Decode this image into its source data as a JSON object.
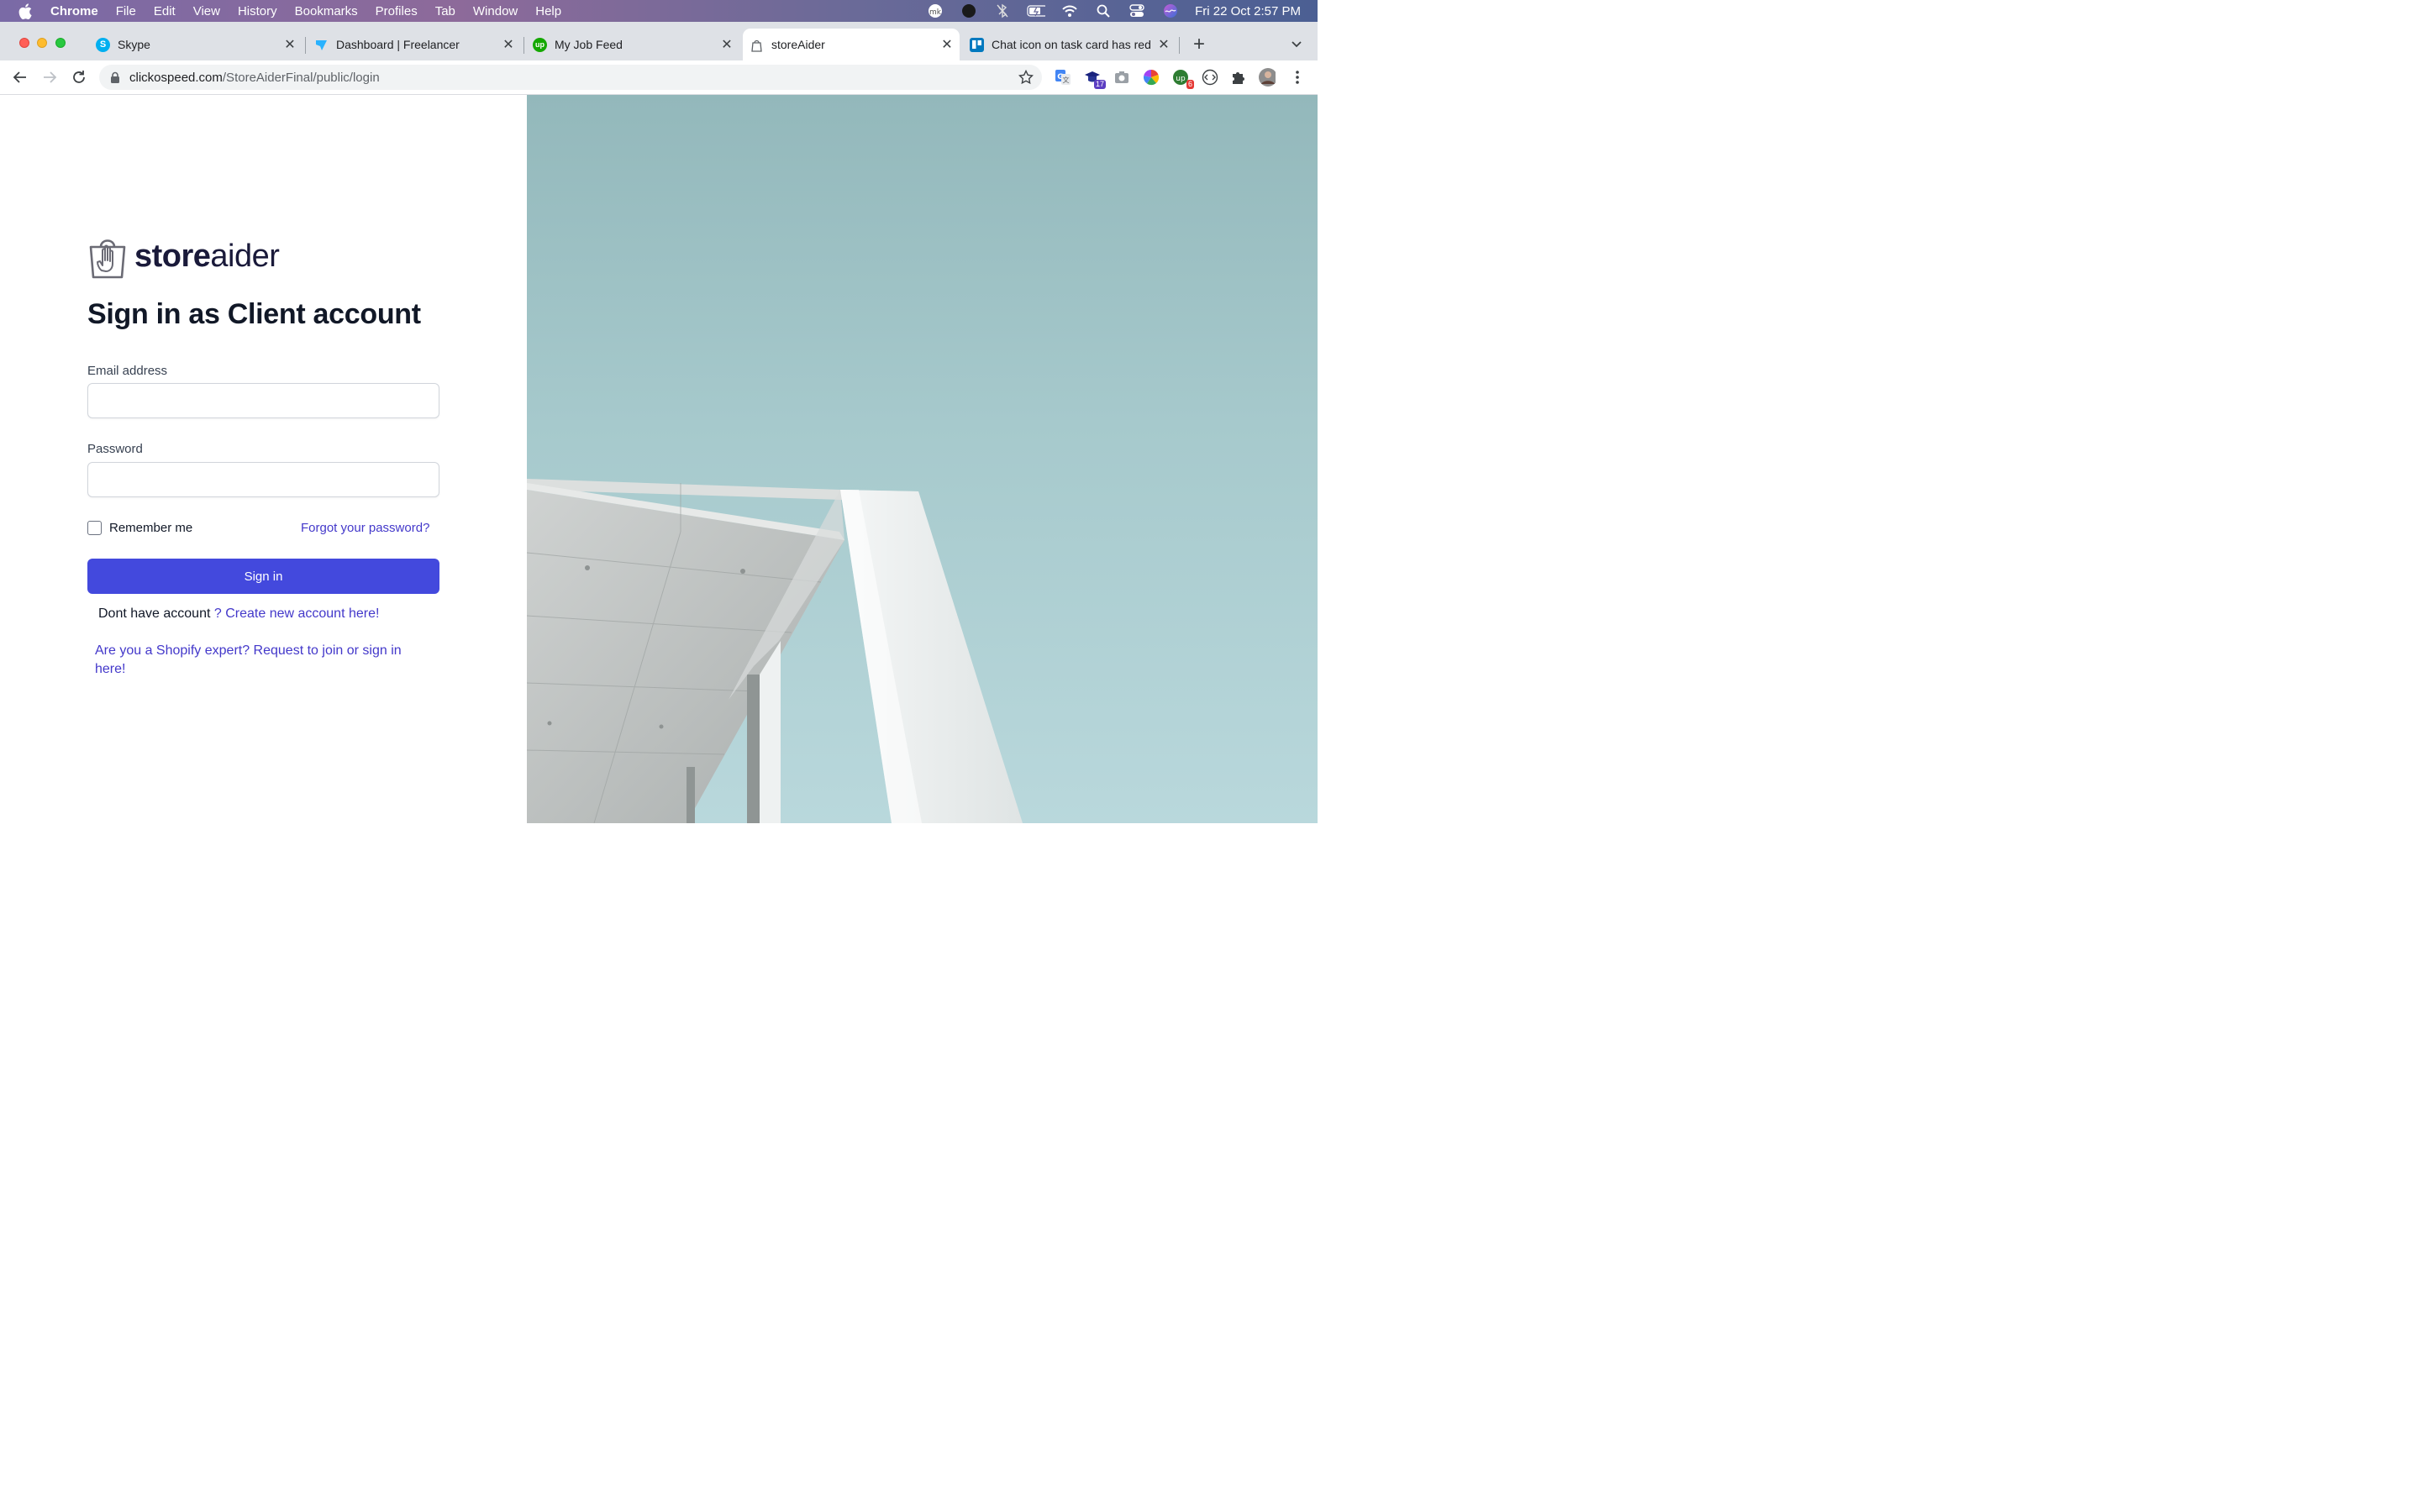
{
  "menubar": {
    "app_name": "Chrome",
    "items": [
      "File",
      "Edit",
      "View",
      "History",
      "Bookmarks",
      "Profiles",
      "Tab",
      "Window",
      "Help"
    ],
    "clock": "Fri 22 Oct  2:57 PM"
  },
  "tabs": [
    {
      "title": "Skype",
      "icon": "skype-icon",
      "color": "#00aff0"
    },
    {
      "title": "Dashboard | Freelancer",
      "icon": "freelancer-icon",
      "color": "#29b2fe"
    },
    {
      "title": "My Job Feed",
      "icon": "upwork-icon",
      "color": "#14a800"
    },
    {
      "title": "storeAider",
      "icon": "storeaider-icon",
      "color": "#5f6368"
    },
    {
      "title": "Chat icon on task card has red",
      "icon": "trello-icon",
      "color": "#0079bf"
    }
  ],
  "address_bar": {
    "host": "clickospeed.com",
    "path": "/StoreAiderFinal/public/login"
  },
  "extensions": {
    "badge_1": "17",
    "badge_2": "6"
  },
  "logo": {
    "bold": "store",
    "regular": "aider"
  },
  "login": {
    "title": "Sign in as Client account",
    "email_label": "Email address",
    "email_value": "",
    "password_label": "Password",
    "password_value": "",
    "remember_label": "Remember me",
    "forgot_link": "Forgot your password?",
    "signin_button": "Sign in",
    "no_account_text": "Dont have account ",
    "create_link": "? Create new account here!",
    "expert_link": "Are you a Shopify expert? Request to join or sign in here!"
  },
  "colors": {
    "primary": "#4349dd",
    "link": "#4338ca",
    "sky": "#a6c9cc"
  }
}
